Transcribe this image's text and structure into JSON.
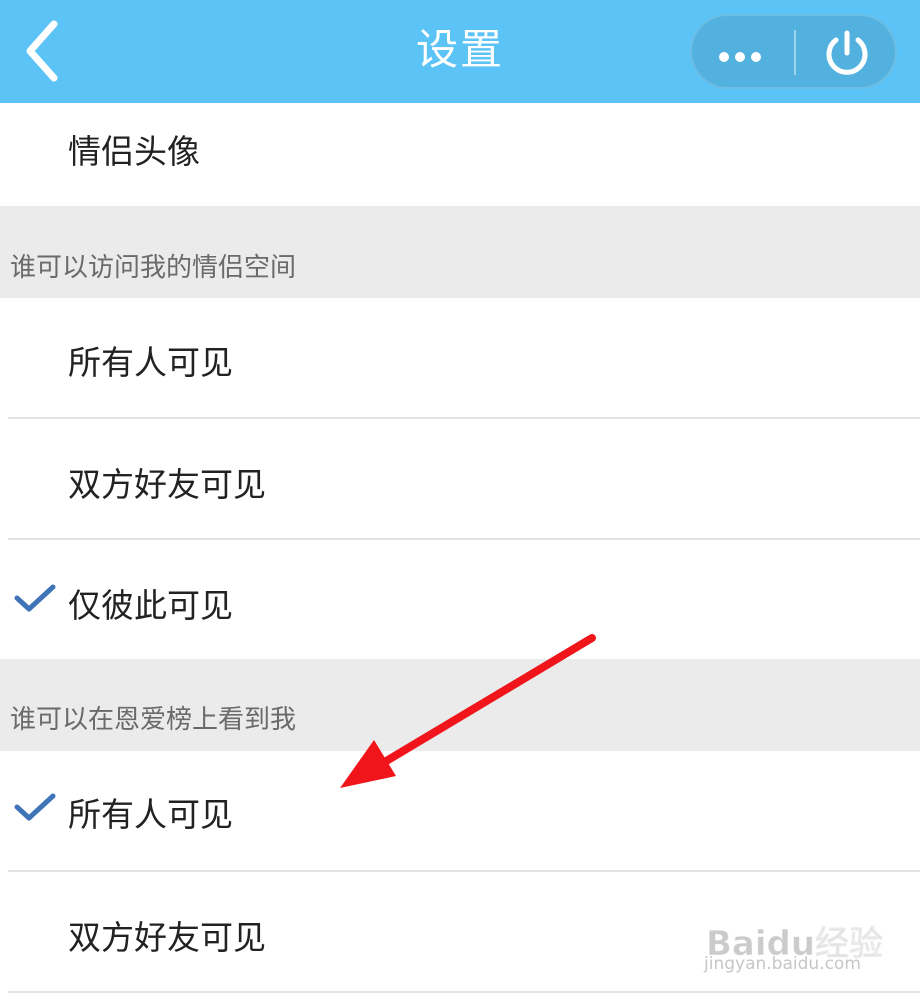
{
  "header": {
    "title": "设置",
    "back_icon": "chevron-left-icon",
    "more_icon": "more-dots-icon",
    "power_icon": "power-icon",
    "background_color": "#5bc3f5"
  },
  "rows": {
    "avatar": {
      "label": "情侣头像"
    }
  },
  "section_visit": {
    "title": "谁可以访问我的情侣空间",
    "options": [
      {
        "label": "所有人可见",
        "checked": false
      },
      {
        "label": "双方好友可见",
        "checked": false
      },
      {
        "label": "仅彼此可见",
        "checked": true
      }
    ]
  },
  "section_ranking": {
    "title": "谁可以在恩爱榜上看到我",
    "options": [
      {
        "label": "所有人可见",
        "checked": true
      },
      {
        "label": "双方好友可见",
        "checked": false
      }
    ]
  },
  "watermark": {
    "logo": "Baidu经验",
    "url": "jingyan.baidu.com"
  },
  "colors": {
    "check": "#3f74b8",
    "annotation_arrow": "#f0151b",
    "section_bg": "#ebebeb"
  }
}
